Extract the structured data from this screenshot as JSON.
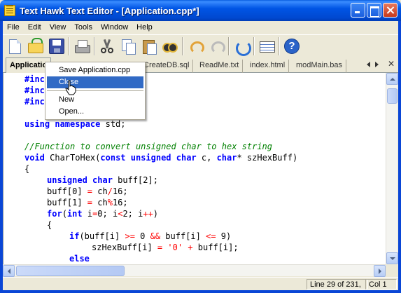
{
  "window": {
    "title": "Text Hawk Text Editor - [Application.cpp*]",
    "title_color": "#ffffff",
    "titlebar_color": "#0055e5"
  },
  "menubar": {
    "items": [
      "File",
      "Edit",
      "View",
      "Tools",
      "Window",
      "Help"
    ]
  },
  "toolbar": {
    "buttons": [
      "new-icon",
      "open-icon",
      "save-icon",
      "print-icon",
      "cut-icon",
      "copy-icon",
      "paste-icon",
      "find-icon",
      "undo-icon",
      "redo-icon",
      "refresh-icon",
      "word-wrap-icon",
      "help-icon"
    ]
  },
  "tabs": {
    "items": [
      "Applicatio",
      "CreateDB.sql",
      "ReadMe.txt",
      "index.html",
      "modMain.bas"
    ],
    "active": "Applicatio"
  },
  "context_menu": {
    "items": [
      "Save Application.cpp",
      "Close",
      "New",
      "Open..."
    ],
    "highlighted": "Close",
    "highlight_color": "#316ac5"
  },
  "editor": {
    "lines": {
      "l0": "#inc",
      "l1": "#inc",
      "l2": "#inc",
      "l4_kw": "using namespace",
      "l4_rest": " std;",
      "l6": "//Function to convert unsigned char to hex string",
      "l7_a": "void",
      "l7_b": " CharToHex(",
      "l7_c": "const unsigned char",
      "l7_d": " c, ",
      "l7_e": "char",
      "l7_f": "* szHexBuff)",
      "l8": "{",
      "l9_a": "unsigned char",
      "l9_b": " buff[2];",
      "l10_a": "buff[0] ",
      "l10_b": "=",
      "l10_c": " ch",
      "l10_d": "/",
      "l10_e": "16;",
      "l11_a": "buff[1] ",
      "l11_b": "=",
      "l11_c": " ch",
      "l11_d": "%",
      "l11_e": "16;",
      "l12_a": "for",
      "l12_b": "(",
      "l12_c": "int",
      "l12_d": " i",
      "l12_e": "=",
      "l12_f": "0; i",
      "l12_g": "<",
      "l12_h": "2; i",
      "l12_i": "++",
      "l12_j": ")",
      "l13": "{",
      "l14_a": "if",
      "l14_b": "(buff[i] ",
      "l14_c": ">=",
      "l14_d": " 0 ",
      "l14_e": "&&",
      "l14_f": " buff[i] ",
      "l14_g": "<=",
      "l14_h": " 9)",
      "l15_a": "szHexBuff[i] ",
      "l15_b": "=",
      "l15_c": " ",
      "l15_d": "'0'",
      "l15_e": " ",
      "l15_f": "+",
      "l15_g": " buff[i];",
      "l16": "else"
    },
    "keyword_color": "#0000ff",
    "comment_color": "#008000",
    "operator_color": "#ff0000"
  },
  "statusbar": {
    "position": "Line 29 of 231,",
    "column": "Col 1"
  }
}
